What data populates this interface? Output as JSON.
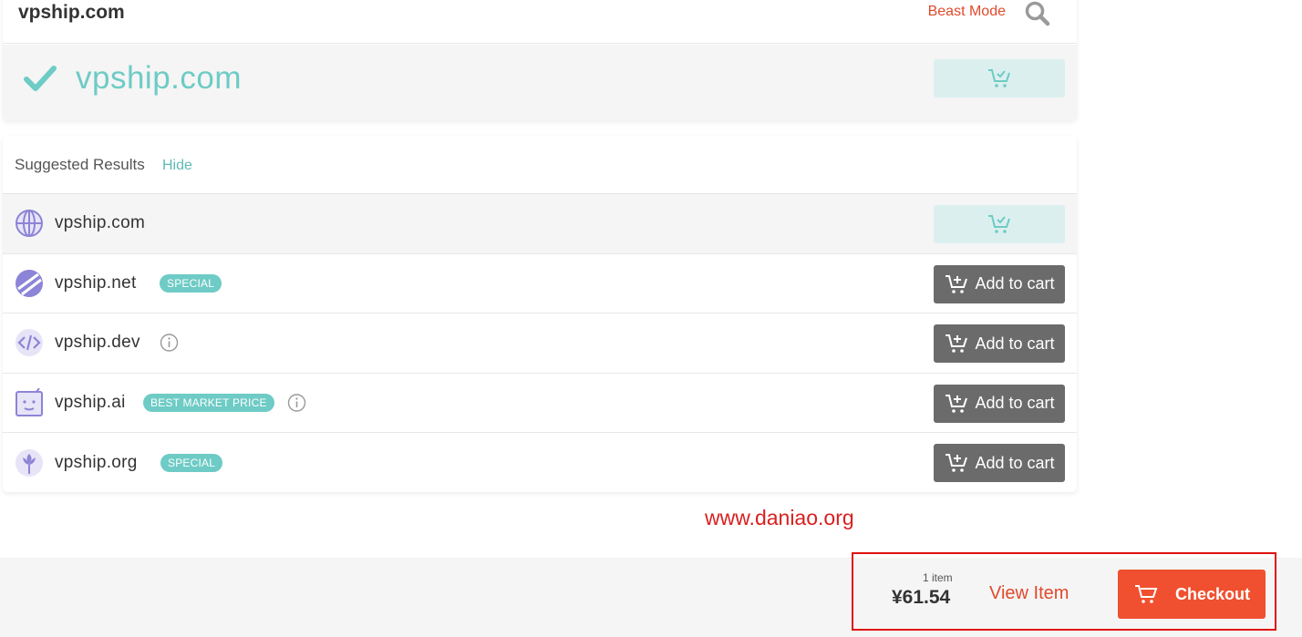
{
  "search": {
    "query": "vpship.com",
    "beast_mode": "Beast Mode",
    "search_icon": "search-icon"
  },
  "result": {
    "domain": "vpship.com",
    "status_icon": "check-icon"
  },
  "suggested": {
    "title": "Suggested Results",
    "hide_label": "Hide",
    "rows": [
      {
        "domain": "vpship.com",
        "icon": "globe-icon",
        "badge": "",
        "info": false,
        "in_cart": true
      },
      {
        "domain": "vpship.net",
        "icon": "net-icon",
        "badge": "SPECIAL",
        "info": false,
        "in_cart": false,
        "button": "Add to cart"
      },
      {
        "domain": "vpship.dev",
        "icon": "code-icon",
        "badge": "",
        "info": true,
        "in_cart": false,
        "button": "Add to cart"
      },
      {
        "domain": "vpship.ai",
        "icon": "robot-icon",
        "badge": "BEST MARKET PRICE",
        "info": true,
        "in_cart": false,
        "button": "Add to cart"
      },
      {
        "domain": "vpship.org",
        "icon": "org-flower-icon",
        "badge": "SPECIAL",
        "info": false,
        "in_cart": false,
        "button": "Add to cart"
      }
    ]
  },
  "watermark": "www.daniao.org",
  "cart": {
    "item_count": "1 item",
    "total": "¥61.54",
    "view_item": "View Item",
    "checkout": "Checkout"
  },
  "colors": {
    "accent_teal": "#6ecbc5",
    "accent_orange": "#f0502f",
    "button_grey": "#6b6b6b",
    "highlight_red": "#e01010"
  }
}
